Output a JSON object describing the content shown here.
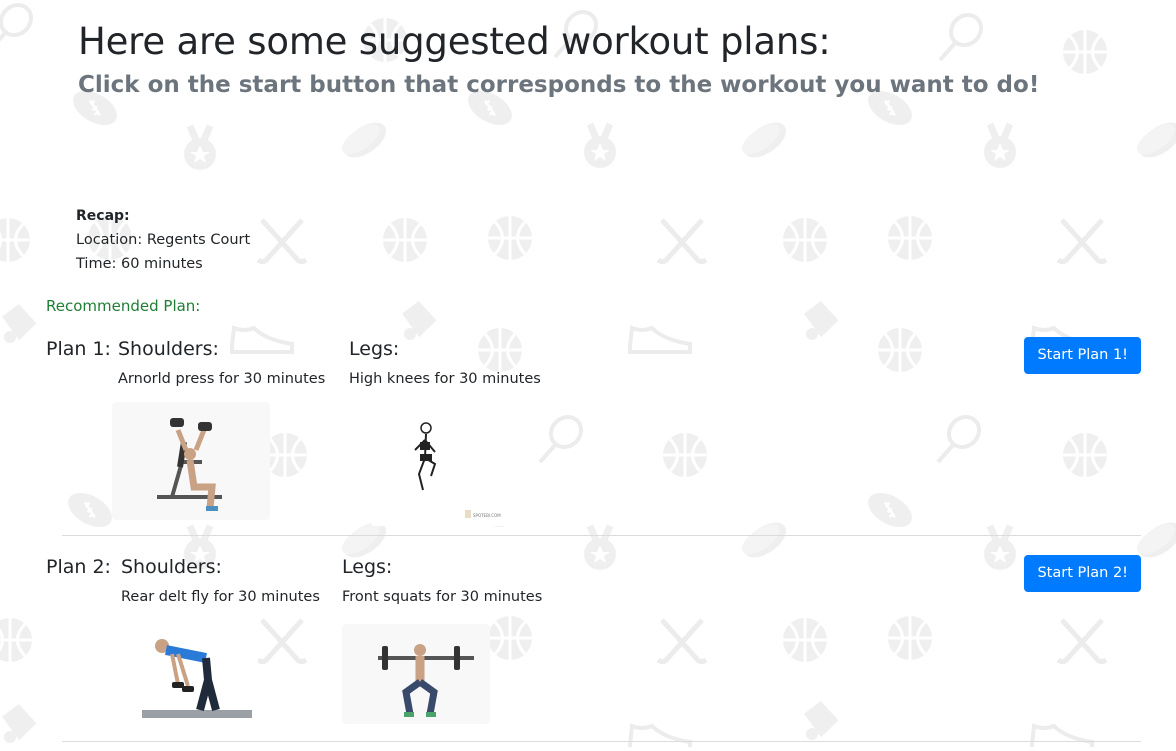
{
  "page": {
    "title": "Here are some suggested workout plans:",
    "subtitle": "Click on the start button that corresponds to the workout you want to do!"
  },
  "recap": {
    "heading": "Recap:",
    "location": "Location: Regents Court",
    "time": "Time: 60 minutes"
  },
  "recommended_label": "Recommended Plan:",
  "plans": [
    {
      "label": "Plan 1:",
      "groups": [
        {
          "title": "Shoulders:",
          "exercise": "Arnorld press for 30 minutes"
        },
        {
          "title": "Legs:",
          "exercise": "High knees for 30 minutes"
        }
      ],
      "button_label": "Start Plan 1!"
    },
    {
      "label": "Plan 2:",
      "groups": [
        {
          "title": "Shoulders:",
          "exercise": "Rear delt fly for 30 minutes"
        },
        {
          "title": "Legs:",
          "exercise": "Front squats for 30 minutes"
        }
      ],
      "button_label": "Start Plan 2!"
    }
  ],
  "colors": {
    "accent": "#007bff",
    "recommended": "#1e7e34",
    "subtitle": "#6c757d",
    "background_icons": "#eeeeee"
  },
  "background": {
    "pattern_icons": [
      "tennis-racket-icon",
      "basketball-icon",
      "football-icon",
      "medal-icon",
      "hockey-puck-icon",
      "volleyball-icon",
      "soccer-ball-icon",
      "hockey-sticks-icon",
      "shuttlecock-icon",
      "sneaker-icon",
      "tennis-ball-icon",
      "jersey-icon"
    ]
  }
}
